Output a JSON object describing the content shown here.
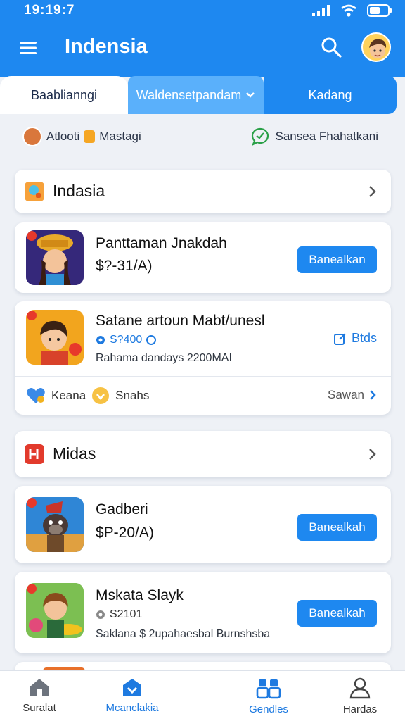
{
  "status": {
    "time": "19:19:7"
  },
  "header": {
    "title": "Indensia"
  },
  "tabs": [
    {
      "label": "Baablianngi"
    },
    {
      "label": "Waldensetpandam"
    },
    {
      "label": "Kadang"
    }
  ],
  "info": {
    "left_a": "Atlooti",
    "left_b": "Mastagi",
    "right": "Sansea Fhahatkani"
  },
  "sections": [
    {
      "title": "Indasia"
    },
    {
      "title": "Midas"
    }
  ],
  "apps": [
    {
      "name": "Panttaman Jnakdah",
      "price": "$?-31/A)",
      "button": "Banealkan"
    },
    {
      "name": "Satane artoun Mabt/unesl",
      "meta": "S?400",
      "sub": "Rahama dandays 2200MAI",
      "button": "Btds"
    },
    {
      "name": "Gadberi",
      "price": "$P-20/A)",
      "button": "Banealkah"
    },
    {
      "name": "Mskata Slayk",
      "meta": "S2101",
      "sub": "Saklana $ 2upahaesbal Burnshsba",
      "button": "Banealkah"
    }
  ],
  "sub_row": {
    "left_a": "Keana",
    "left_b": "Snahs",
    "right": "Sawan"
  },
  "bottom_nav": [
    {
      "label": "Suralat"
    },
    {
      "label": "Mcanclakia"
    },
    {
      "label": "Gendles"
    },
    {
      "label": "Hardas"
    }
  ],
  "colors": {
    "primary": "#1e88f0",
    "tab_active": "#5ab0fb",
    "background": "#eef1f6"
  }
}
